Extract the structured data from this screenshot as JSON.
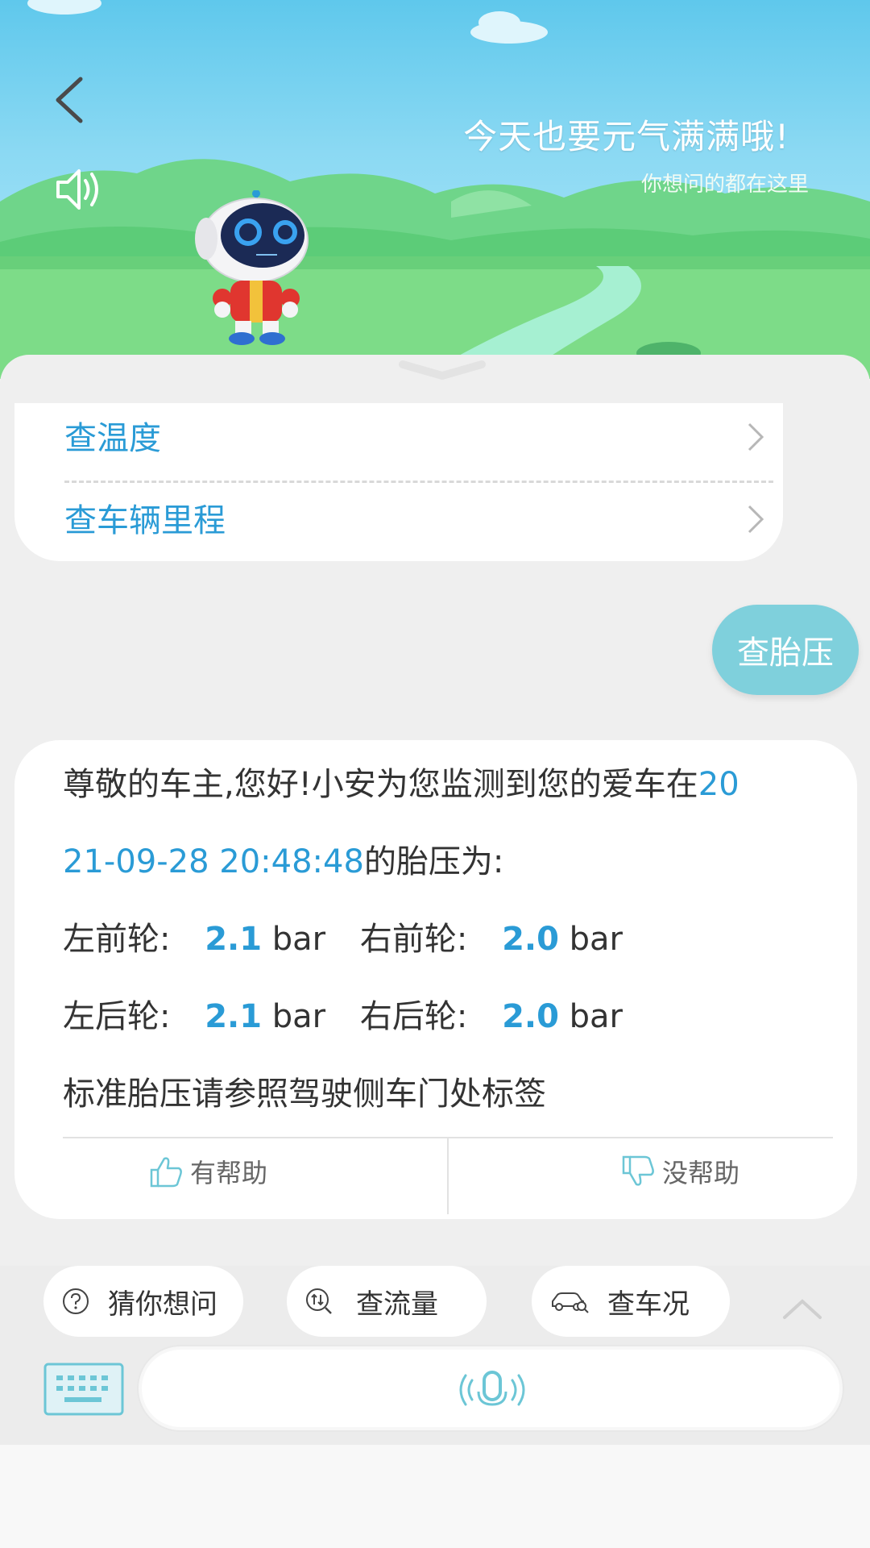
{
  "header": {
    "slogan": "今天也要元气满满哦!",
    "sub_slogan": "你想问的都在这里",
    "back_icon": "chevron-left-icon",
    "speaker_icon": "speaker-icon"
  },
  "menu": {
    "items": [
      {
        "label": "查温度",
        "icon": "chevron-right-icon"
      },
      {
        "label": "查车辆里程",
        "icon": "chevron-right-icon"
      }
    ]
  },
  "user_message": "查胎压",
  "answer": {
    "intro_prefix": "尊敬的车主,您好!小安为您监测到您的爱车在",
    "date_part1": "20",
    "date_part2": "21-09-28 20:48:48",
    "intro_suffix": "的胎压为:",
    "front_left_label": "左前轮:",
    "front_left_value": "2.1",
    "front_right_label": "右前轮:",
    "front_right_value": "2.0",
    "rear_left_label": "左后轮:",
    "rear_left_value": "2.1",
    "rear_right_label": "右后轮:",
    "rear_right_value": "2.0",
    "unit": "bar",
    "note": "标准胎压请参照驾驶侧车门处标签",
    "helpful_label": "有帮助",
    "not_helpful_label": "没帮助"
  },
  "quick_chips": [
    {
      "label": "猜你想问",
      "icon": "question-circle-icon"
    },
    {
      "label": "查流量",
      "icon": "data-flow-icon"
    },
    {
      "label": "查车况",
      "icon": "car-search-icon"
    }
  ],
  "input": {
    "keyboard_icon": "keyboard-icon",
    "voice_icon": "microphone-icon"
  },
  "colors": {
    "accent_blue": "#2a9bd6",
    "user_bubble": "#7fd0dc",
    "icon_teal": "#6cc6d6"
  }
}
